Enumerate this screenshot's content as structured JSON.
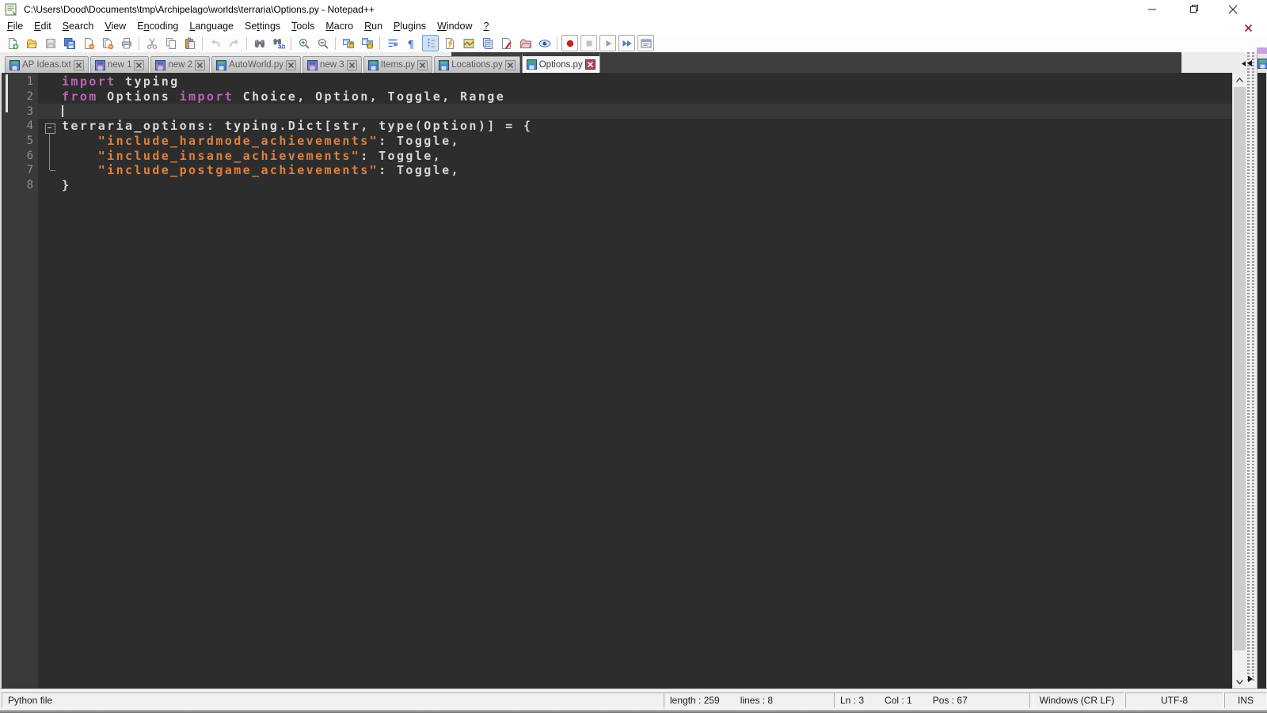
{
  "window": {
    "title": "C:\\Users\\Dood\\Documents\\tmp\\Archipelago\\worlds\\terraria\\Options.py - Notepad++"
  },
  "menu": {
    "items": [
      {
        "id": "file",
        "label": "File",
        "mnemonic_index": 0
      },
      {
        "id": "edit",
        "label": "Edit",
        "mnemonic_index": 0
      },
      {
        "id": "search",
        "label": "Search",
        "mnemonic_index": 0
      },
      {
        "id": "view",
        "label": "View",
        "mnemonic_index": 0
      },
      {
        "id": "encoding",
        "label": "Encoding",
        "mnemonic_index": 1
      },
      {
        "id": "language",
        "label": "Language",
        "mnemonic_index": 0
      },
      {
        "id": "settings",
        "label": "Settings",
        "mnemonic_index": 2
      },
      {
        "id": "tools",
        "label": "Tools",
        "mnemonic_index": 0
      },
      {
        "id": "macro",
        "label": "Macro",
        "mnemonic_index": 0
      },
      {
        "id": "run",
        "label": "Run",
        "mnemonic_index": 0
      },
      {
        "id": "plugins",
        "label": "Plugins",
        "mnemonic_index": 0
      },
      {
        "id": "window",
        "label": "Window",
        "mnemonic_index": 0
      },
      {
        "id": "help",
        "label": "?",
        "mnemonic_index": 0
      }
    ]
  },
  "toolbar": {
    "groups": [
      [
        {
          "name": "new-file"
        },
        {
          "name": "open-file"
        },
        {
          "name": "save",
          "disabled": true
        },
        {
          "name": "save-all"
        },
        {
          "name": "close-file"
        },
        {
          "name": "close-all"
        },
        {
          "name": "print"
        }
      ],
      [
        {
          "name": "cut"
        },
        {
          "name": "copy"
        },
        {
          "name": "paste"
        }
      ],
      [
        {
          "name": "undo",
          "disabled": true
        },
        {
          "name": "redo",
          "disabled": true
        }
      ],
      [
        {
          "name": "find"
        },
        {
          "name": "replace"
        }
      ],
      [
        {
          "name": "zoom-in"
        },
        {
          "name": "zoom-out"
        }
      ],
      [
        {
          "name": "sync-vertical"
        },
        {
          "name": "sync-horizontal"
        }
      ],
      [
        {
          "name": "word-wrap"
        },
        {
          "name": "show-all-characters"
        },
        {
          "name": "show-indent-guide",
          "active": true
        },
        {
          "name": "user-defined-language"
        },
        {
          "name": "document-map"
        },
        {
          "name": "document-list"
        },
        {
          "name": "function-list"
        },
        {
          "name": "folder-as-workspace"
        },
        {
          "name": "monitoring"
        }
      ],
      [
        {
          "name": "macro-record",
          "framed": true
        },
        {
          "name": "macro-stop",
          "framed": true,
          "disabled": true
        },
        {
          "name": "macro-play",
          "framed": true
        },
        {
          "name": "macro-run-multiple",
          "framed": true
        },
        {
          "name": "macro-save",
          "framed": true
        }
      ]
    ]
  },
  "tabs": [
    {
      "id": "ap-ideas",
      "label": "AP Ideas.txt",
      "modified": false,
      "active": false
    },
    {
      "id": "new-1",
      "label": "new 1",
      "modified": true,
      "active": false
    },
    {
      "id": "new-2",
      "label": "new 2",
      "modified": true,
      "active": false
    },
    {
      "id": "autoworld",
      "label": "AutoWorld.py",
      "modified": false,
      "active": false
    },
    {
      "id": "new-3",
      "label": "new 3",
      "modified": true,
      "active": false
    },
    {
      "id": "items",
      "label": "Items.py",
      "modified": false,
      "active": false
    },
    {
      "id": "locations",
      "label": "Locations.py",
      "modified": false,
      "active": false
    },
    {
      "id": "options",
      "label": "Options.py",
      "modified": false,
      "active": true
    }
  ],
  "editor": {
    "caret_line": 3,
    "lines": [
      {
        "n": 1,
        "tokens": [
          {
            "t": "import",
            "c": "k"
          },
          {
            "t": " typing",
            "c": "d"
          }
        ]
      },
      {
        "n": 2,
        "tokens": [
          {
            "t": "from",
            "c": "k"
          },
          {
            "t": " Options ",
            "c": "d"
          },
          {
            "t": "import",
            "c": "k"
          },
          {
            "t": " Choice, Option, Toggle, Range",
            "c": "d"
          }
        ]
      },
      {
        "n": 3,
        "tokens": []
      },
      {
        "n": 4,
        "tokens": [
          {
            "t": "terraria_options: typing.Dict[str, type(Option)] = {",
            "c": "d"
          }
        ]
      },
      {
        "n": 5,
        "tokens": [
          {
            "t": "    ",
            "c": "d"
          },
          {
            "t": "\"include_hardmode_achievements\"",
            "c": "s"
          },
          {
            "t": ": Toggle,",
            "c": "d"
          }
        ]
      },
      {
        "n": 6,
        "tokens": [
          {
            "t": "    ",
            "c": "d"
          },
          {
            "t": "\"include_insane_achievements\"",
            "c": "s"
          },
          {
            "t": ": Toggle,",
            "c": "d"
          }
        ]
      },
      {
        "n": 7,
        "tokens": [
          {
            "t": "    ",
            "c": "d"
          },
          {
            "t": "\"include_postgame_achievements\"",
            "c": "s"
          },
          {
            "t": ": Toggle,",
            "c": "d"
          }
        ]
      },
      {
        "n": 8,
        "tokens": [
          {
            "t": "}",
            "c": "d"
          }
        ]
      }
    ]
  },
  "status": {
    "sections": [
      {
        "id": "doc-type",
        "parts": [
          "Python file"
        ]
      },
      {
        "id": "doc-size",
        "parts": [
          "length : 259",
          "lines : 8"
        ]
      },
      {
        "id": "cursor-pos",
        "parts": [
          "Ln : 3",
          "Col : 1",
          "Pos : 67"
        ]
      },
      {
        "id": "eol-format",
        "parts": [
          "Windows (CR LF)"
        ]
      },
      {
        "id": "encoding",
        "parts": [
          "UTF-8"
        ]
      },
      {
        "id": "typing-mode",
        "parts": [
          "INS"
        ]
      }
    ]
  },
  "colors": {
    "editor_bg": "#2d2d2d",
    "margin_bg": "#3a3a3a",
    "keyword": "#bb62bb",
    "default_text": "#d6d6d6",
    "string": "#dd8040",
    "line_number": "#8f8f8f",
    "active_tab_accent": "#3e3e3e",
    "indent_button_active_bg": "#cfe2f5"
  }
}
